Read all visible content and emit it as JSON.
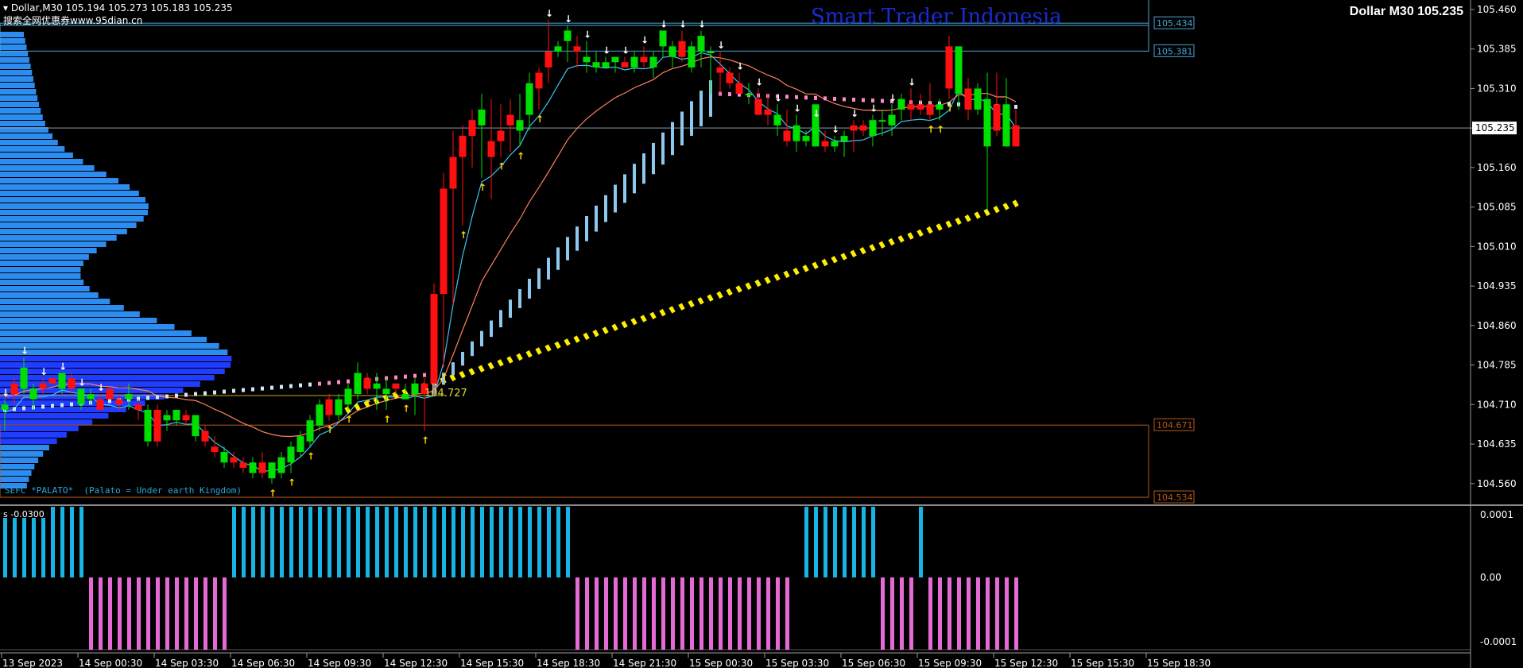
{
  "header": {
    "symbol_line": "Dollar,M30",
    "ohlc": "105.194 105.273 105.183 105.235",
    "watermark": "搜索全网优惠券www.95dian.cn",
    "title_right": "Dollar M30 105.235",
    "brand": "Smart Trader Indonesia",
    "indicator_label": "SEFC *PALATO*  (Palato = Under earth Kingdom)",
    "subwindow_label": "s -0.0300",
    "level_label": "104.727"
  },
  "price_axis": {
    "ticks": [
      "105.460",
      "105.385",
      "105.310",
      "105.235",
      "105.160",
      "105.085",
      "105.010",
      "104.935",
      "104.860",
      "104.785",
      "104.710",
      "104.635",
      "104.560"
    ],
    "current": "105.235",
    "boxes": [
      {
        "label": "105.434",
        "color": "#4aa6d6"
      },
      {
        "label": "105.381",
        "color": "#4aa6d6"
      },
      {
        "label": "104.671",
        "color": "#b85a1a"
      },
      {
        "label": "104.534",
        "color": "#b85a1a"
      }
    ]
  },
  "sub_axis": {
    "ticks": [
      "0.0001",
      "0.00",
      "-0.0001"
    ]
  },
  "time_axis": {
    "labels": [
      "13 Sep 2023",
      "14 Sep 00:30",
      "14 Sep 03:30",
      "14 Sep 06:30",
      "14 Sep 09:30",
      "14 Sep 12:30",
      "14 Sep 15:30",
      "14 Sep 18:30",
      "14 Sep 21:30",
      "15 Sep 00:30",
      "15 Sep 03:30",
      "15 Sep 06:30",
      "15 Sep 09:30",
      "15 Sep 12:30",
      "15 Sep 15:30",
      "15 Sep 18:30"
    ]
  },
  "chart_data": {
    "type": "candlestick",
    "symbol": "Dollar",
    "timeframe": "M30",
    "bull_color": "#00e000",
    "bear_color": "#ff1010",
    "y_range": [
      104.522,
      105.478
    ],
    "candles": [
      [
        104.7,
        104.72,
        104.66,
        104.71
      ],
      [
        104.75,
        104.76,
        104.71,
        104.73
      ],
      [
        104.74,
        104.8,
        104.73,
        104.78
      ],
      [
        104.72,
        104.75,
        104.7,
        104.74
      ],
      [
        104.75,
        104.76,
        104.73,
        104.74
      ],
      [
        104.76,
        104.76,
        104.75,
        104.75
      ],
      [
        104.74,
        104.77,
        104.73,
        104.77
      ],
      [
        104.76,
        104.77,
        104.73,
        104.74
      ],
      [
        104.71,
        104.74,
        104.7,
        104.74
      ],
      [
        104.72,
        104.74,
        104.71,
        104.73
      ],
      [
        104.72,
        104.73,
        104.7,
        104.7
      ],
      [
        104.74,
        104.74,
        104.72,
        104.72
      ],
      [
        104.72,
        104.73,
        104.7,
        104.71
      ],
      [
        104.72,
        104.75,
        104.7,
        104.73
      ],
      [
        104.71,
        104.72,
        104.68,
        104.7
      ],
      [
        104.64,
        104.71,
        104.63,
        104.7
      ],
      [
        104.7,
        104.71,
        104.63,
        104.64
      ],
      [
        104.68,
        104.7,
        104.66,
        104.69
      ],
      [
        104.68,
        104.7,
        104.67,
        104.7
      ],
      [
        104.69,
        104.7,
        104.67,
        104.68
      ],
      [
        104.65,
        104.69,
        104.64,
        104.69
      ],
      [
        104.66,
        104.67,
        104.63,
        104.64
      ],
      [
        104.63,
        104.65,
        104.61,
        104.62
      ],
      [
        104.6,
        104.63,
        104.59,
        104.62
      ],
      [
        104.61,
        104.62,
        104.59,
        104.6
      ],
      [
        104.6,
        104.61,
        104.58,
        104.59
      ],
      [
        104.58,
        104.61,
        104.57,
        104.6
      ],
      [
        104.6,
        104.62,
        104.57,
        104.58
      ],
      [
        104.57,
        104.6,
        104.56,
        104.6
      ],
      [
        104.58,
        104.62,
        104.57,
        104.61
      ],
      [
        104.6,
        104.64,
        104.58,
        104.63
      ],
      [
        104.62,
        104.66,
        104.61,
        104.65
      ],
      [
        104.64,
        104.69,
        104.63,
        104.68
      ],
      [
        104.67,
        104.72,
        104.66,
        104.71
      ],
      [
        104.72,
        104.73,
        104.68,
        104.69
      ],
      [
        104.69,
        104.73,
        104.68,
        104.72
      ],
      [
        104.71,
        104.75,
        104.7,
        104.74
      ],
      [
        104.73,
        104.79,
        104.72,
        104.77
      ],
      [
        104.76,
        104.77,
        104.73,
        104.74
      ],
      [
        104.74,
        104.77,
        104.7,
        104.75
      ],
      [
        104.73,
        104.76,
        104.7,
        104.74
      ],
      [
        104.75,
        104.75,
        104.73,
        104.74
      ],
      [
        104.72,
        104.75,
        104.72,
        104.73
      ],
      [
        104.73,
        104.76,
        104.69,
        104.75
      ],
      [
        104.75,
        104.76,
        104.66,
        104.73
      ],
      [
        104.92,
        104.94,
        104.73,
        104.75
      ],
      [
        105.12,
        105.15,
        104.78,
        104.92
      ],
      [
        105.18,
        105.23,
        104.9,
        105.12
      ],
      [
        105.22,
        105.24,
        105.05,
        105.18
      ],
      [
        105.25,
        105.27,
        105.16,
        105.22
      ],
      [
        105.24,
        105.3,
        105.14,
        105.27
      ],
      [
        105.21,
        105.29,
        105.1,
        105.18
      ],
      [
        105.23,
        105.28,
        105.18,
        105.21
      ],
      [
        105.26,
        105.29,
        105.19,
        105.24
      ],
      [
        105.23,
        105.3,
        105.2,
        105.25
      ],
      [
        105.26,
        105.34,
        105.23,
        105.32
      ],
      [
        105.34,
        105.35,
        105.27,
        105.31
      ],
      [
        105.38,
        105.44,
        105.32,
        105.35
      ],
      [
        105.38,
        105.4,
        105.37,
        105.39
      ],
      [
        105.4,
        105.43,
        105.36,
        105.42
      ],
      [
        105.39,
        105.41,
        105.35,
        105.38
      ],
      [
        105.36,
        105.4,
        105.34,
        105.37
      ],
      [
        105.35,
        105.38,
        105.34,
        105.36
      ],
      [
        105.35,
        105.37,
        105.35,
        105.36
      ],
      [
        105.36,
        105.37,
        105.34,
        105.37
      ],
      [
        105.36,
        105.37,
        105.35,
        105.35
      ],
      [
        105.35,
        105.38,
        105.34,
        105.37
      ],
      [
        105.37,
        105.39,
        105.35,
        105.36
      ],
      [
        105.35,
        105.38,
        105.33,
        105.37
      ],
      [
        105.39,
        105.42,
        105.37,
        105.42
      ],
      [
        105.37,
        105.4,
        105.35,
        105.39
      ],
      [
        105.4,
        105.42,
        105.36,
        105.37
      ],
      [
        105.35,
        105.4,
        105.34,
        105.39
      ],
      [
        105.38,
        105.42,
        105.35,
        105.41
      ],
      [
        105.38,
        105.39,
        105.3,
        105.38
      ],
      [
        105.35,
        105.38,
        105.3,
        105.34
      ],
      [
        105.34,
        105.35,
        105.31,
        105.32
      ],
      [
        105.32,
        105.34,
        105.3,
        105.3
      ],
      [
        105.3,
        105.32,
        105.28,
        105.3
      ],
      [
        105.29,
        105.31,
        105.26,
        105.26
      ],
      [
        105.27,
        105.3,
        105.24,
        105.26
      ],
      [
        105.24,
        105.28,
        105.22,
        105.26
      ],
      [
        105.23,
        105.27,
        105.2,
        105.21
      ],
      [
        105.21,
        105.26,
        105.19,
        105.24
      ],
      [
        105.21,
        105.23,
        105.2,
        105.22
      ],
      [
        105.2,
        105.25,
        105.2,
        105.28
      ],
      [
        105.21,
        105.23,
        105.19,
        105.2
      ],
      [
        105.2,
        105.22,
        105.19,
        105.21
      ],
      [
        105.21,
        105.23,
        105.18,
        105.22
      ],
      [
        105.24,
        105.25,
        105.19,
        105.23
      ],
      [
        105.24,
        105.25,
        105.22,
        105.23
      ],
      [
        105.22,
        105.26,
        105.2,
        105.25
      ],
      [
        105.25,
        105.27,
        105.22,
        105.25
      ],
      [
        105.24,
        105.28,
        105.22,
        105.26
      ],
      [
        105.27,
        105.3,
        105.25,
        105.29
      ],
      [
        105.28,
        105.31,
        105.25,
        105.27
      ],
      [
        105.28,
        105.3,
        105.26,
        105.27
      ],
      [
        105.28,
        105.32,
        105.25,
        105.26
      ],
      [
        105.27,
        105.29,
        105.25,
        105.28
      ],
      [
        105.39,
        105.41,
        105.29,
        105.31
      ],
      [
        105.3,
        105.39,
        105.27,
        105.39
      ],
      [
        105.31,
        105.33,
        105.25,
        105.27
      ],
      [
        105.27,
        105.32,
        105.26,
        105.31
      ],
      [
        105.2,
        105.34,
        105.08,
        105.29
      ],
      [
        105.28,
        105.34,
        105.22,
        105.23
      ],
      [
        105.2,
        105.33,
        105.2,
        105.28
      ],
      [
        105.24,
        105.27,
        105.2,
        105.2
      ]
    ],
    "supports": [
      {
        "name": "104.727",
        "value": 104.727
      },
      {
        "value": 105.434
      },
      {
        "value": 105.381
      },
      {
        "value": 104.671
      },
      {
        "value": 104.534
      }
    ]
  }
}
